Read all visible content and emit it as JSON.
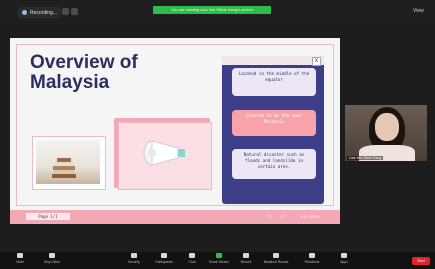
{
  "top_bar": {
    "share_label": "Recording...",
    "viewing_banner": "You are viewing Lisa Yee Shine Kang's screen",
    "view_label": "View"
  },
  "slide": {
    "title": "Overview of Malaysia",
    "popup_close": "x",
    "bubbles": [
      "Located in the middle of the equator",
      "Granted to be the same Malaysia",
      "Natural disaster such as floods and landslide in certain ares."
    ],
    "page_label": "Page 1/1",
    "controls": {
      "left_arrow": "<",
      "right_arrow": ">",
      "zoom": "1:1 / 100%"
    }
  },
  "video": {
    "participant_name": "Lisa Yee Shine Kang"
  },
  "toolbar": {
    "items": [
      {
        "label": "Mute",
        "icon": "microphone-icon"
      },
      {
        "label": "Stop Video",
        "icon": "camera-icon"
      },
      {
        "label": "Security",
        "icon": "shield-icon"
      },
      {
        "label": "Participants",
        "icon": "participants-icon"
      },
      {
        "label": "Chat",
        "icon": "chat-icon"
      },
      {
        "label": "Share Screen",
        "icon": "share-screen-icon"
      },
      {
        "label": "Record",
        "icon": "record-icon"
      },
      {
        "label": "Breakout Rooms",
        "icon": "breakout-icon"
      },
      {
        "label": "Reactions",
        "icon": "reactions-icon"
      },
      {
        "label": "Apps",
        "icon": "apps-icon"
      }
    ],
    "end_label": "End"
  },
  "colors": {
    "slide_title": "#2b2f5f",
    "panel": "#3c3f87",
    "pink_accent": "#f3a8b5",
    "banner_green": "#2ebd4d",
    "end_red": "#e0262c"
  }
}
